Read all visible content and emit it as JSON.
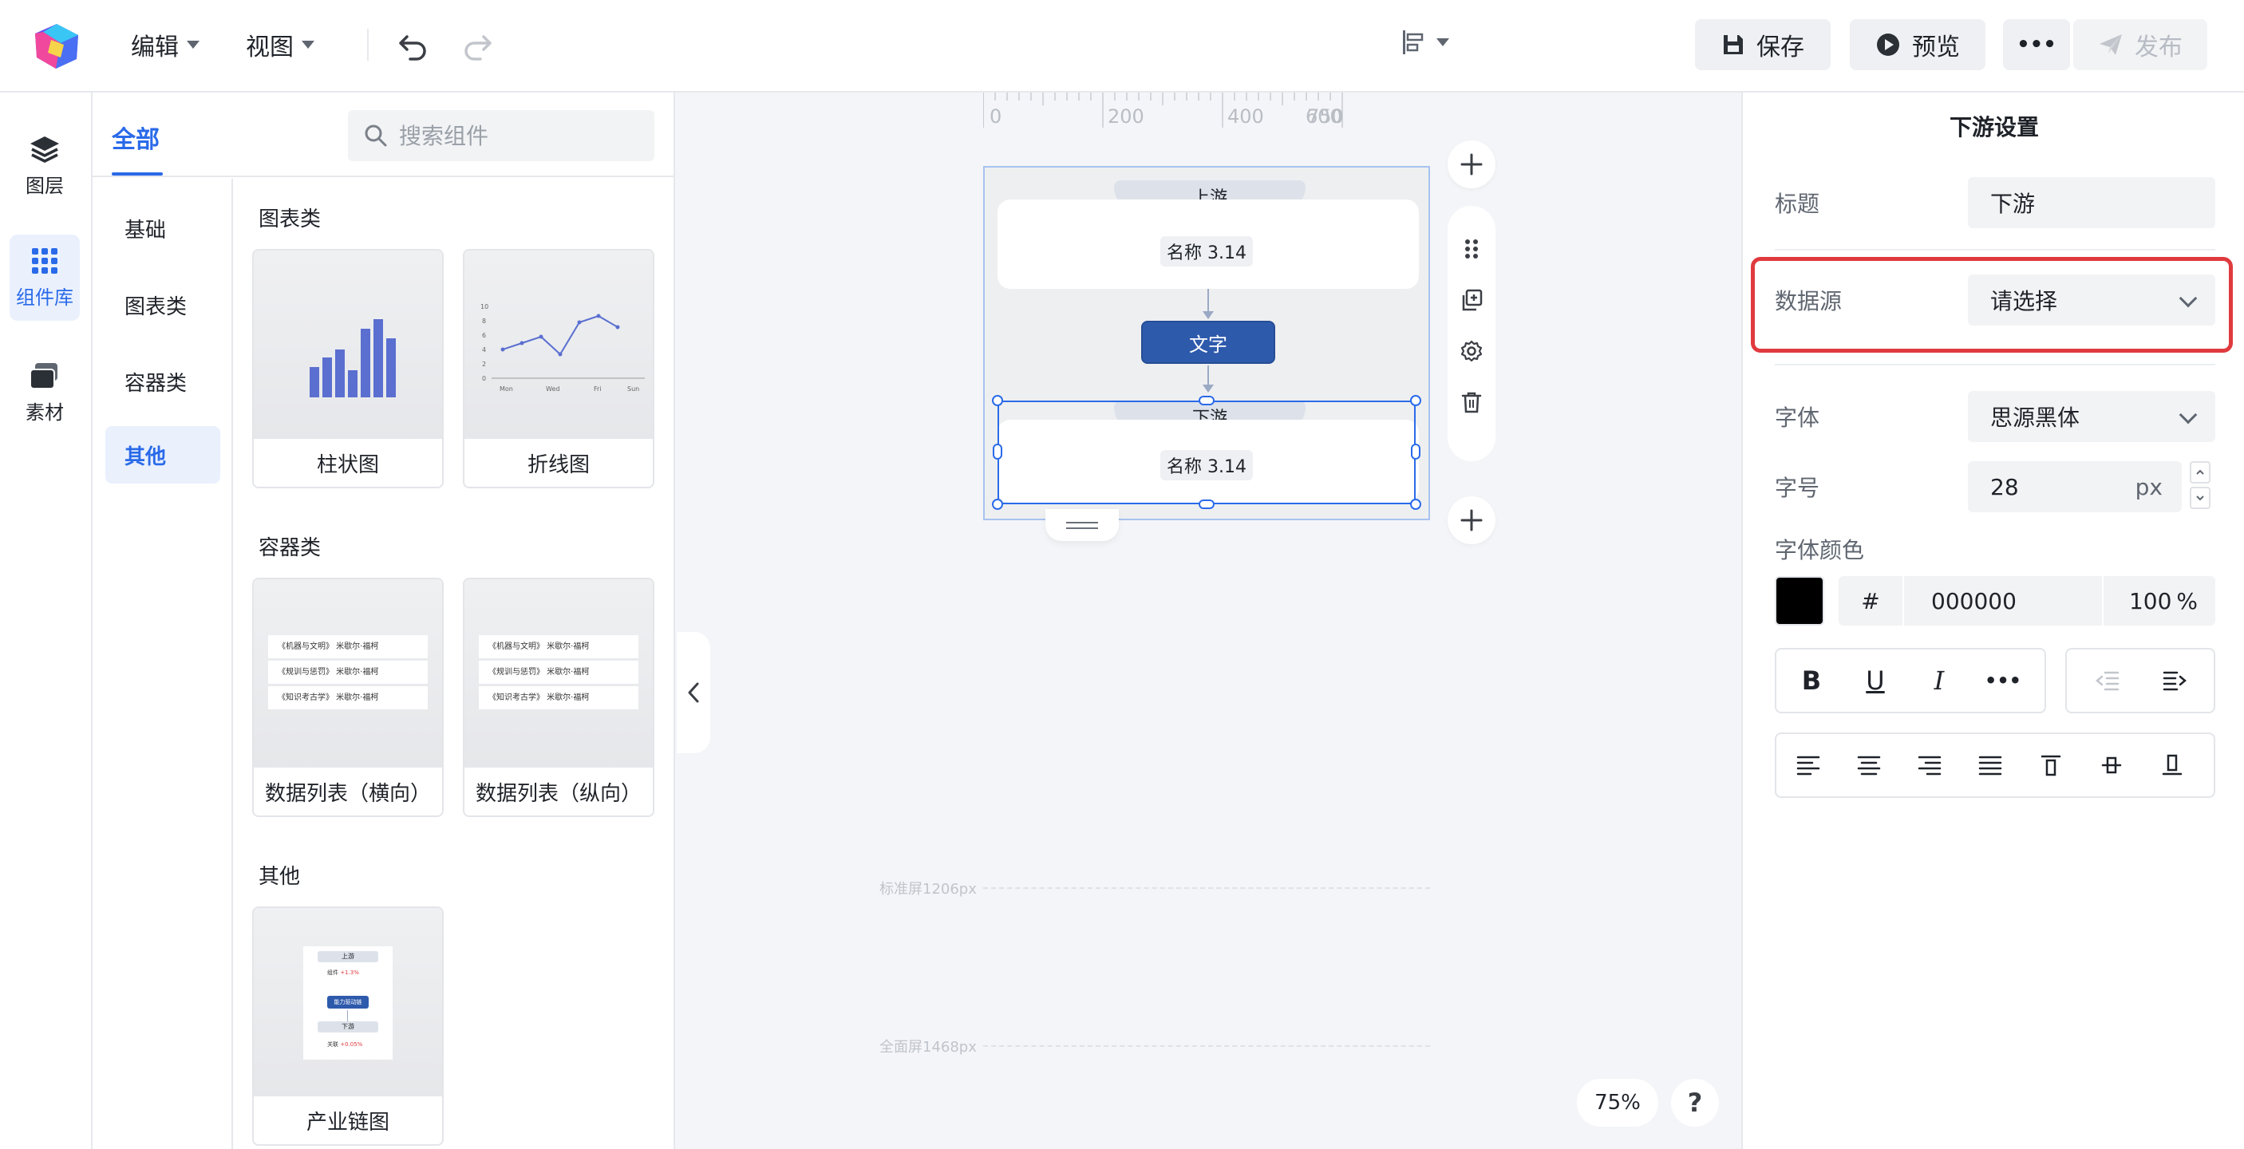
{
  "topbar": {
    "menus": [
      {
        "label": "编辑"
      },
      {
        "label": "视图"
      }
    ],
    "save_label": "保存",
    "preview_label": "预览",
    "more_label": "•••",
    "publish_label": "发布"
  },
  "rail": {
    "items": [
      {
        "label": "图层",
        "icon": "layers-icon"
      },
      {
        "label": "组件库",
        "icon": "grid-icon",
        "active": true
      },
      {
        "label": "素材",
        "icon": "assets-icon"
      }
    ]
  },
  "library": {
    "tab": "全部",
    "search_placeholder": "搜索组件",
    "categories": [
      {
        "label": "基础"
      },
      {
        "label": "图表类"
      },
      {
        "label": "容器类"
      },
      {
        "label": "其他",
        "active": true
      }
    ],
    "sections": [
      {
        "title": "图表类",
        "cards": [
          {
            "label": "柱状图"
          },
          {
            "label": "折线图"
          }
        ]
      },
      {
        "title": "容器类",
        "cards": [
          {
            "label": "数据列表（横向）"
          },
          {
            "label": "数据列表（纵向）"
          }
        ]
      },
      {
        "title": "其他",
        "cards": [
          {
            "label": "产业链图"
          }
        ]
      }
    ],
    "line_thumb": {
      "y_ticks": [
        "10",
        "8",
        "6",
        "4",
        "2",
        "0"
      ],
      "x_ticks": [
        "Mon",
        "Wed",
        "Fri",
        "Sun"
      ]
    },
    "list_thumb_rows": [
      "《机器与文明》 米歇尔·福柯",
      "《规训与惩罚》 米歇尔·福柯",
      "《知识考古学》 米歇尔·福柯"
    ],
    "chain_thumb": {
      "up": "上游",
      "up_chip_name": "组件",
      "up_chip_value": "+1.3%",
      "mid": "能力驱动链",
      "down": "下游",
      "down_chip_name": "关联",
      "down_chip_value": "+0.05%"
    }
  },
  "canvas": {
    "ruler_labels": [
      "0",
      "200",
      "400",
      "600",
      "750"
    ],
    "standard_screen_label": "标准屏1206px",
    "full_screen_label": "全面屏1468px",
    "zoom": "75%",
    "help": "?",
    "artboard": {
      "upstream_title": "上游",
      "upstream_chip": "名称 3.14",
      "middle_button": "文字",
      "downstream_title": "下游",
      "downstream_chip": "名称 3.14"
    }
  },
  "props": {
    "title": "下游设置",
    "title_label": "标题",
    "title_value": "下游",
    "datasource_label": "数据源",
    "datasource_value": "请选择",
    "font_label": "字体",
    "font_value": "思源黑体",
    "fontsize_label": "字号",
    "fontsize_value": "28",
    "fontsize_unit": "px",
    "fontcolor_label": "字体颜色",
    "color_hash": "#",
    "color_hex": "000000",
    "color_opacity": "100",
    "color_opacity_unit": "%",
    "bold_label": "B",
    "underline_label": "U",
    "italic_label": "I",
    "more_label": "•••"
  },
  "colors": {
    "accent": "#2a6ae9",
    "node_button": "#2e5aac",
    "highlight": "#e03a3e",
    "font_color": "#000000"
  }
}
